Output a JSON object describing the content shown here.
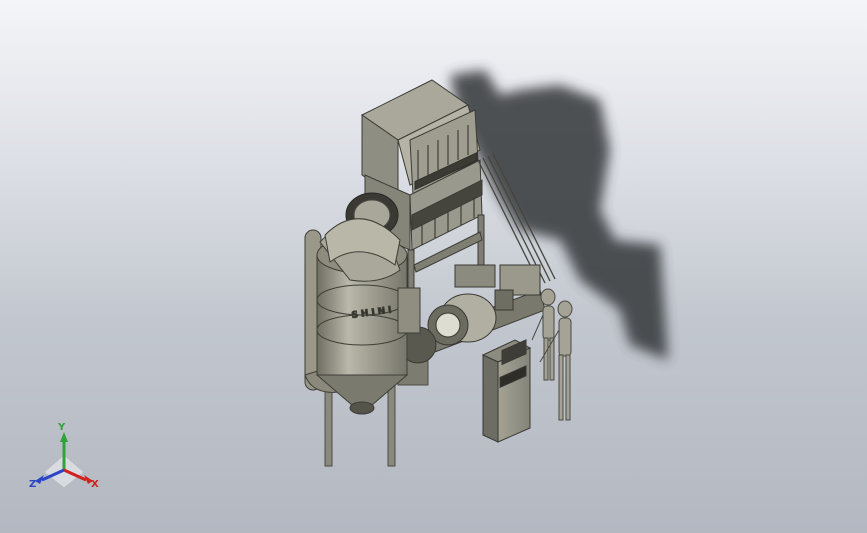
{
  "viewport": {
    "model_label": "SHINI",
    "triad": {
      "x_label": "X",
      "y_label": "Y",
      "z_label": "Z"
    },
    "colors": {
      "machine_body": "#8f8e80",
      "machine_dark": "#5c5b51",
      "machine_light": "#b3b2a4",
      "shadow": "#3a3d40",
      "axis_x": "#d0221e",
      "axis_y": "#2fa33a",
      "axis_z": "#2a45c8"
    }
  }
}
